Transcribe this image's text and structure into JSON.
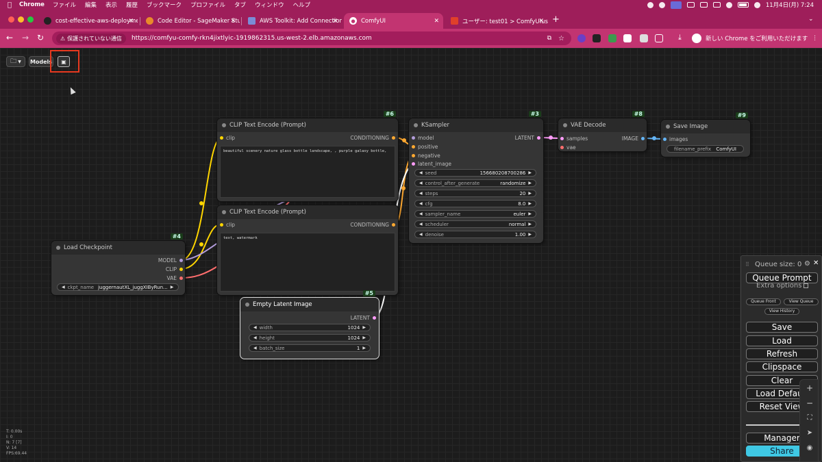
{
  "os_menubar": {
    "app": "Chrome",
    "items": [
      "ファイル",
      "編集",
      "表示",
      "履歴",
      "ブックマーク",
      "プロファイル",
      "タブ",
      "ウィンドウ",
      "ヘルプ"
    ],
    "clock": "11月4日(月)  7:24"
  },
  "browser": {
    "tabs": [
      {
        "label": "cost-effective-aws-deployme",
        "icon": "github-icon"
      },
      {
        "label": "Code Editor - SageMaker Stu",
        "icon": "sagemaker-icon"
      },
      {
        "label": "AWS Toolkit: Add Connection",
        "icon": "aws-toolkit-icon"
      },
      {
        "label": "ComfyUI",
        "icon": "comfyui-icon"
      },
      {
        "label": "ユーザー: test01 > ComfyUIus",
        "icon": "cognito-icon"
      }
    ],
    "new_tab": "+",
    "security_warning": "保護されていない通信",
    "url_scheme": "https://",
    "url_host": "comfyu-comfy-rkn4jixtlyic-1919862315.us-west-2.elb.amazonaws.com",
    "promo": "新しい Chrome をご利用いただけます",
    "colors": {
      "frame": "#9e1e5a",
      "toolbar": "#c23471"
    }
  },
  "toolbar": {
    "models_label": "Models"
  },
  "nodes": {
    "clip_pos": {
      "id": "#6",
      "title": "CLIP Text Encode (Prompt)",
      "input": "clip",
      "output": "CONDITIONING",
      "text": "beautiful scenery nature glass bottle landscape, , purple galaxy bottle,"
    },
    "clip_neg": {
      "title": "CLIP Text Encode (Prompt)",
      "input": "clip",
      "output": "CONDITIONING",
      "text": "text, watermark"
    },
    "ksampler": {
      "id": "#3",
      "title": "KSampler",
      "inputs": [
        "model",
        "positive",
        "negative",
        "latent_image"
      ],
      "output": "LATENT",
      "widgets": [
        {
          "label": "seed",
          "value": "156680208700286"
        },
        {
          "label": "control_after_generate",
          "value": "randomize"
        },
        {
          "label": "steps",
          "value": "20"
        },
        {
          "label": "cfg",
          "value": "8.0"
        },
        {
          "label": "sampler_name",
          "value": "euler"
        },
        {
          "label": "scheduler",
          "value": "normal"
        },
        {
          "label": "denoise",
          "value": "1.00"
        }
      ]
    },
    "vae_decode": {
      "id": "#8",
      "title": "VAE Decode",
      "inputs": [
        "samples",
        "vae"
      ],
      "output": "IMAGE"
    },
    "save_image": {
      "id": "#9",
      "title": "Save Image",
      "input": "images",
      "widget": {
        "label": "filename_prefix",
        "value": "ComfyUI"
      }
    },
    "load_checkpoint": {
      "id": "#4",
      "title": "Load Checkpoint",
      "outputs": [
        "MODEL",
        "CLIP",
        "VAE"
      ],
      "widget": {
        "label": "ckpt_name",
        "value": "juggernautXL_juggXIByRun..."
      }
    },
    "empty_latent": {
      "id": "#5",
      "title": "Empty Latent Image",
      "output": "LATENT",
      "widgets": [
        {
          "label": "width",
          "value": "1024"
        },
        {
          "label": "height",
          "value": "1024"
        },
        {
          "label": "batch_size",
          "value": "1"
        }
      ]
    }
  },
  "stats": [
    "T: 0.00s",
    "I: 0",
    "N: 7 [7]",
    "V: 14",
    "FPS:69.44"
  ],
  "queue": {
    "size_label": "Queue size: 0",
    "queue_prompt": "Queue Prompt",
    "extra_options": "Extra options",
    "queue_front": "Queue Front",
    "view_queue": "View Queue",
    "view_history": "View History",
    "save": "Save",
    "load": "Load",
    "refresh": "Refresh",
    "clipspace": "Clipspace",
    "clear": "Clear",
    "load_default": "Load Default",
    "reset_view": "Reset View",
    "manager": "Manager",
    "share": "Share"
  },
  "pin_colors": {
    "model": "#b39ddb",
    "clip": "#ffd500",
    "vae": "#ff6e6e",
    "conditioning": "#ffa931",
    "latent": "#ff9cf9",
    "image": "#64b5f6"
  }
}
